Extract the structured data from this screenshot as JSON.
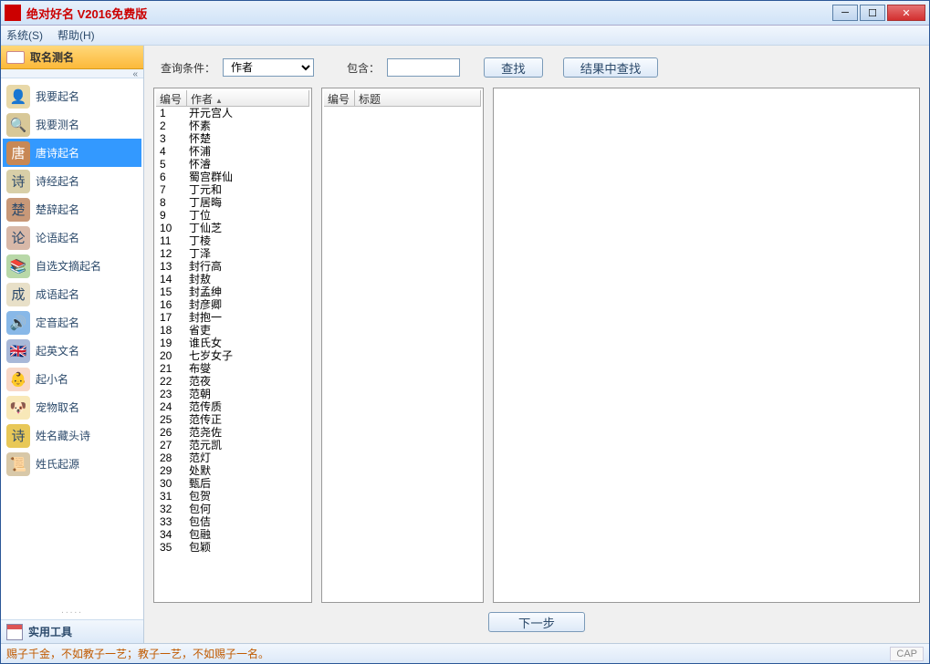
{
  "window": {
    "title": "绝对好名 V2016免费版"
  },
  "menu": {
    "system": "系统(S)",
    "help": "帮助(H)"
  },
  "sidebar": {
    "header": "取名测名",
    "footer": "实用工具",
    "items": [
      {
        "label": "我要起名",
        "icon": "👤",
        "bg": "#e8d8a8"
      },
      {
        "label": "我要测名",
        "icon": "🔍",
        "bg": "#d8c898"
      },
      {
        "label": "唐诗起名",
        "icon": "唐",
        "bg": "#c88855",
        "sel": true
      },
      {
        "label": "诗经起名",
        "icon": "诗",
        "bg": "#d8cfa8"
      },
      {
        "label": "楚辞起名",
        "icon": "楚",
        "bg": "#c89878"
      },
      {
        "label": "论语起名",
        "icon": "论",
        "bg": "#d8b8a8"
      },
      {
        "label": "自选文摘起名",
        "icon": "📚",
        "bg": "#b8d8a8"
      },
      {
        "label": "成语起名",
        "icon": "成",
        "bg": "#e8e0c8"
      },
      {
        "label": "定音起名",
        "icon": "🔊",
        "bg": "#88b8e8"
      },
      {
        "label": "起英文名",
        "icon": "🇬🇧",
        "bg": "#a8b8d8"
      },
      {
        "label": "起小名",
        "icon": "👶",
        "bg": "#f8d8c8"
      },
      {
        "label": "宠物取名",
        "icon": "🐶",
        "bg": "#f8e8b8"
      },
      {
        "label": "姓名藏头诗",
        "icon": "诗",
        "bg": "#e8c858"
      },
      {
        "label": "姓氏起源",
        "icon": "📜",
        "bg": "#d8c8a8"
      }
    ]
  },
  "search": {
    "condition_label": "查询条件：",
    "condition_value": "作者",
    "contains_label": "包含：",
    "contains_value": "",
    "find": "查找",
    "find_in_results": "结果中查找"
  },
  "table1": {
    "cols": [
      "编号",
      "作者"
    ],
    "rows": [
      [
        "1",
        "开元宫人"
      ],
      [
        "2",
        "怀素"
      ],
      [
        "3",
        "怀楚"
      ],
      [
        "4",
        "怀浦"
      ],
      [
        "5",
        "怀濬"
      ],
      [
        "6",
        "蜀宫群仙"
      ],
      [
        "7",
        "丁元和"
      ],
      [
        "8",
        "丁居晦"
      ],
      [
        "9",
        "丁位"
      ],
      [
        "10",
        "丁仙芝"
      ],
      [
        "11",
        "丁棱"
      ],
      [
        "12",
        "丁泽"
      ],
      [
        "13",
        "封行高"
      ],
      [
        "14",
        "封敖"
      ],
      [
        "15",
        "封孟绅"
      ],
      [
        "16",
        "封彦卿"
      ],
      [
        "17",
        "封抱一"
      ],
      [
        "18",
        "省吏"
      ],
      [
        "19",
        "谁氏女"
      ],
      [
        "20",
        "七岁女子"
      ],
      [
        "21",
        "布燮"
      ],
      [
        "22",
        "范夜"
      ],
      [
        "23",
        "范朝"
      ],
      [
        "24",
        "范传质"
      ],
      [
        "25",
        "范传正"
      ],
      [
        "26",
        "范尧佐"
      ],
      [
        "27",
        "范元凯"
      ],
      [
        "28",
        "范灯"
      ],
      [
        "29",
        "处默"
      ],
      [
        "30",
        "甄后"
      ],
      [
        "31",
        "包贺"
      ],
      [
        "32",
        "包何"
      ],
      [
        "33",
        "包佶"
      ],
      [
        "34",
        "包融"
      ],
      [
        "35",
        "包颖"
      ]
    ]
  },
  "table2": {
    "cols": [
      "编号",
      "标题"
    ]
  },
  "next": "下一步",
  "status": {
    "text": "赐子千金，不如教子一艺；教子一艺，不如赐子一名。",
    "cap": "CAP"
  }
}
